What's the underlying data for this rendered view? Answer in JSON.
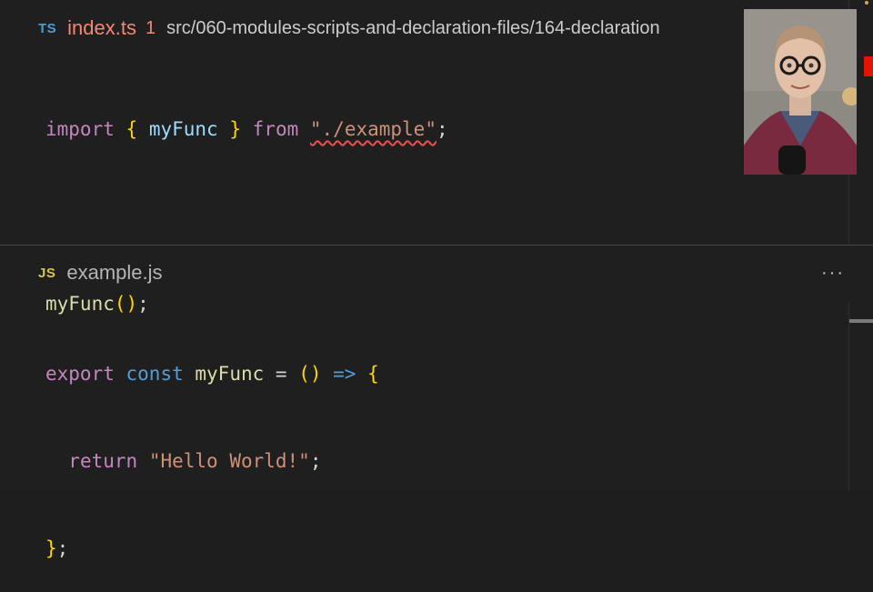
{
  "top_editor": {
    "lang_badge": "TS",
    "file_name": "index.ts",
    "error_count": "1",
    "path": "src/060-modules-scripts-and-declaration-files/164-declaration",
    "lines": [
      [
        "import",
        " ",
        "{",
        " ",
        "myFunc",
        " ",
        "}",
        " ",
        "from",
        " ",
        "\"./example\"",
        ";"
      ],
      [],
      [
        "myFunc",
        "()",
        ";"
      ]
    ]
  },
  "bottom_editor": {
    "lang_badge": "JS",
    "file_name": "example.js",
    "more_label": "···",
    "lines": [
      [
        "export",
        " ",
        "const",
        " ",
        "myFunc",
        " = ",
        "()",
        " ",
        "=>",
        " ",
        "{"
      ],
      [
        "  ",
        "return",
        " ",
        "\"Hello World!\"",
        ";"
      ],
      [
        "}",
        ";"
      ]
    ]
  },
  "colors": {
    "error": "#f48771",
    "ts_badge": "#4b9dd6",
    "js_badge": "#d8c84a",
    "background": "#1f1f1f"
  }
}
